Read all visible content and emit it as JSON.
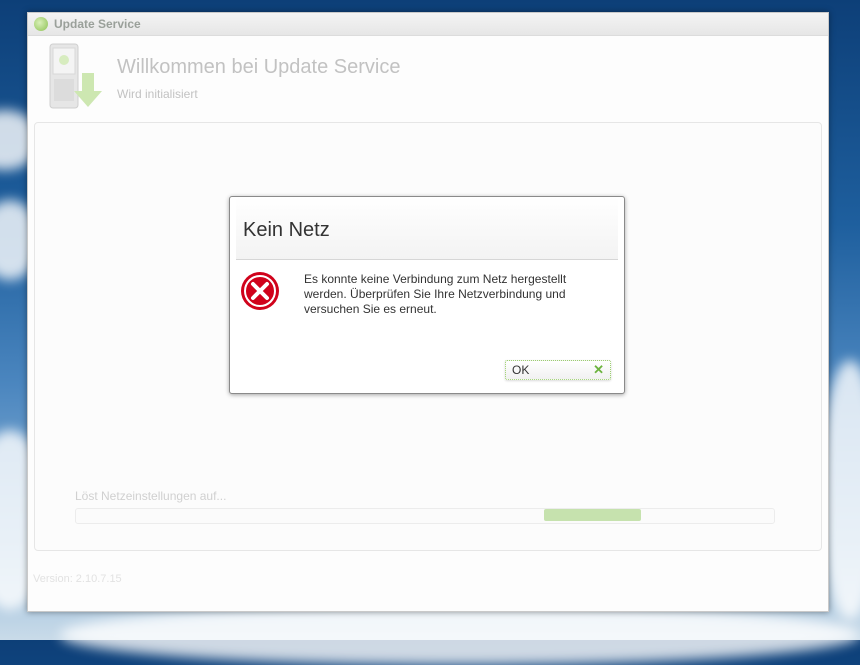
{
  "window": {
    "title": "Update Service",
    "icon": "app-logo-icon"
  },
  "header": {
    "title": "Willkommen bei Update Service",
    "subtitle": "Wird initialisiert",
    "icon": "phone-download-icon"
  },
  "main": {
    "status_text": "Löst Netzeinstellungen auf...",
    "progress_fraction_start": 0.67,
    "progress_fraction_end": 0.81,
    "version": "Version: 2.10.7.15"
  },
  "dialog": {
    "title": "Kein Netz",
    "message": "Es konnte keine Verbindung zum Netz hergestellt werden. Überprüfen Sie Ihre Netzverbindung und versuchen Sie es erneut.",
    "icon": "error-icon",
    "ok_label": "OK",
    "ok_icon": "check-icon"
  },
  "colors": {
    "accent_green": "#8cc152",
    "error_red": "#d0021b"
  }
}
